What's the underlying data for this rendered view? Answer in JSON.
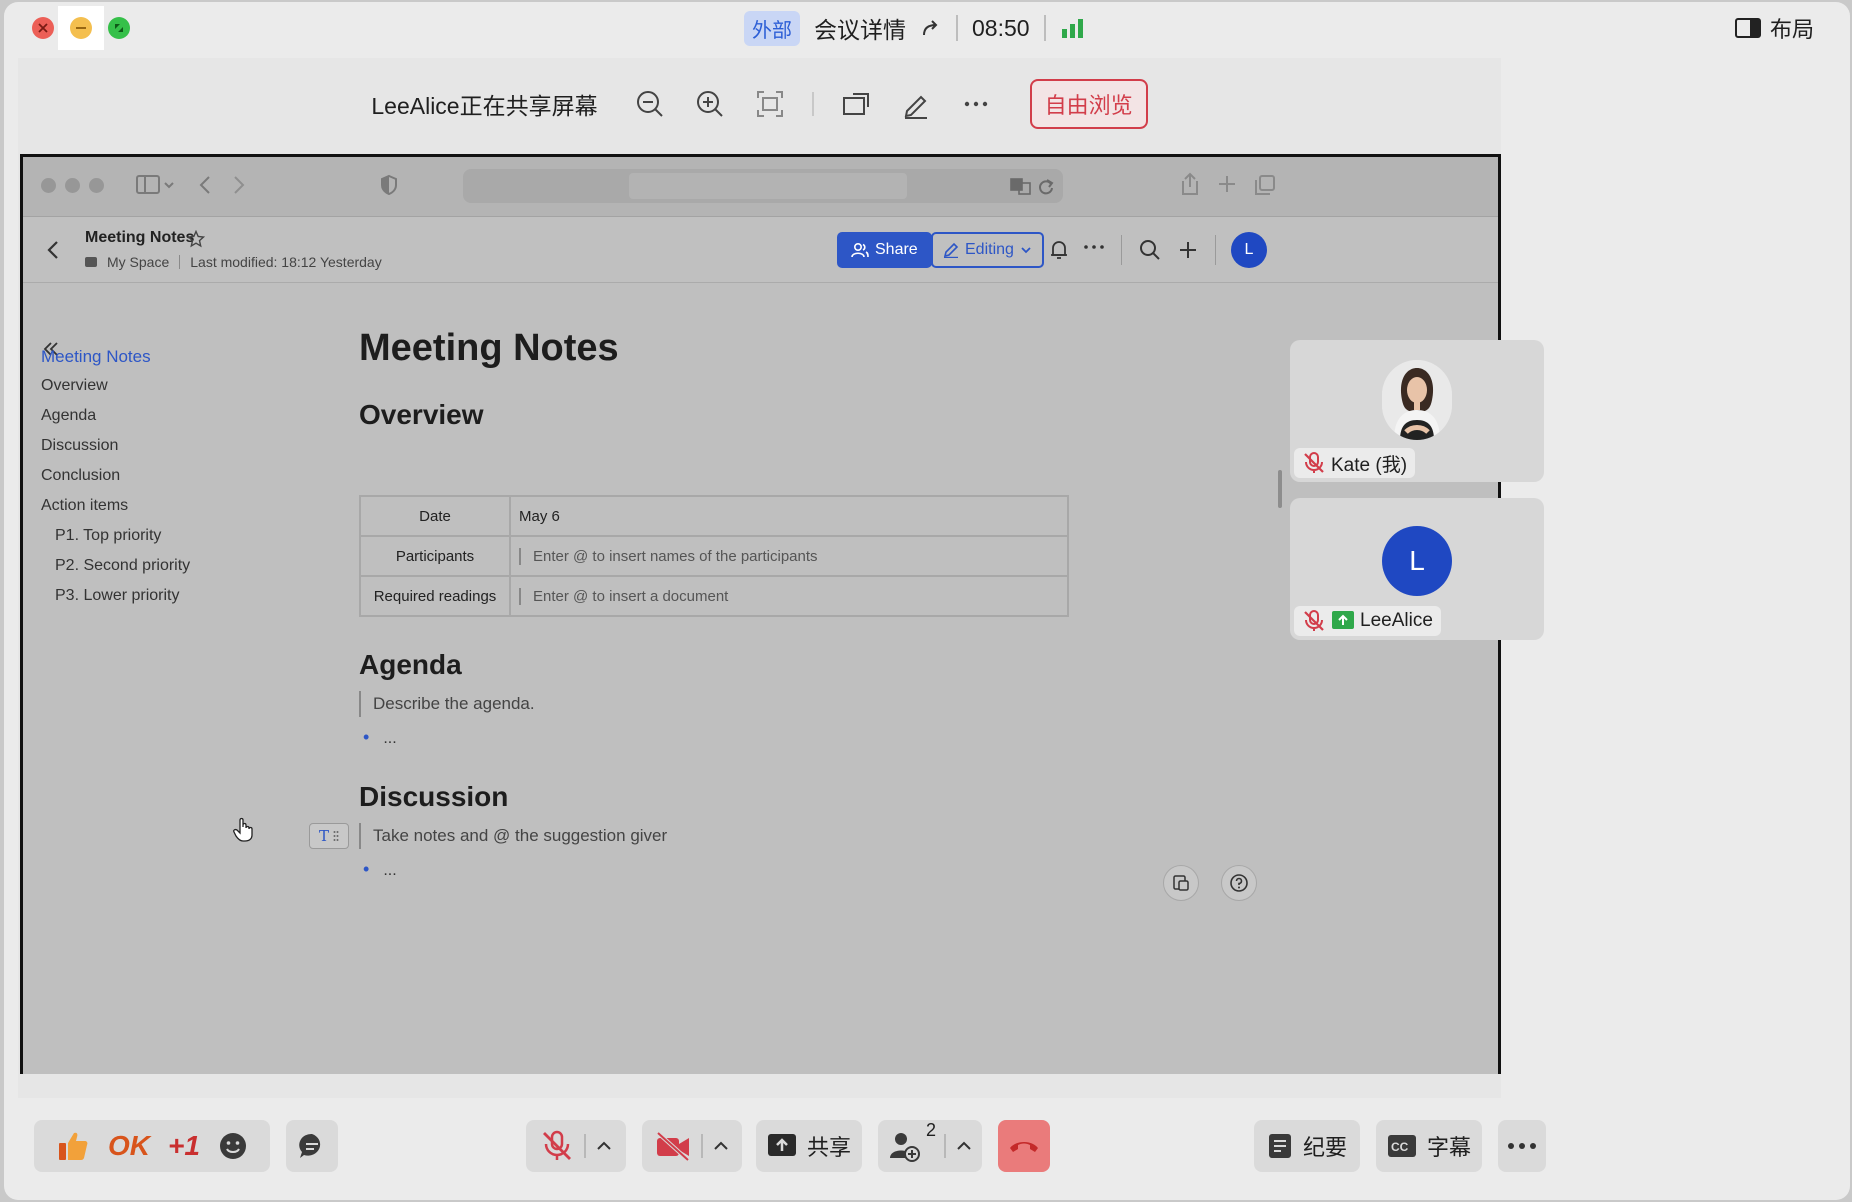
{
  "titlebar": {
    "external_badge": "外部",
    "meeting_details": "会议详情",
    "clock": "08:50",
    "layout_label": "布局"
  },
  "share_toolbar": {
    "title": "LeeAlice正在共享屏幕",
    "free_browse_label": "自由浏览"
  },
  "doc": {
    "breadcrumb_title": "Meeting Notes",
    "space": "My Space",
    "last_modified": "Last modified: 18:12 Yesterday",
    "share_label": "Share",
    "editing_label": "Editing",
    "avatar_initial": "L",
    "toc": {
      "items": [
        {
          "label": "Meeting Notes",
          "level": 1,
          "active": true
        },
        {
          "label": "Overview",
          "level": 1
        },
        {
          "label": "Agenda",
          "level": 1
        },
        {
          "label": "Discussion",
          "level": 1
        },
        {
          "label": "Conclusion",
          "level": 1
        },
        {
          "label": "Action items",
          "level": 1
        },
        {
          "label": "P1. Top priority",
          "level": 2
        },
        {
          "label": "P2. Second priority",
          "level": 2
        },
        {
          "label": "P3. Lower priority",
          "level": 2
        }
      ]
    },
    "title": "Meeting Notes",
    "overview_heading": "Overview",
    "table": [
      {
        "key": "Date",
        "value": "May 6",
        "placeholder": false
      },
      {
        "key": "Participants",
        "value": "Enter @ to insert names of the participants",
        "placeholder": true
      },
      {
        "key": "Required readings",
        "value": "Enter @ to insert a document",
        "placeholder": true
      }
    ],
    "agenda_heading": "Agenda",
    "agenda_placeholder": "Describe the agenda.",
    "agenda_bullet": "...",
    "discussion_heading": "Discussion",
    "discussion_placeholder": "Take notes and @ the suggestion giver",
    "discussion_bullet": "...",
    "block_type_icon": "T"
  },
  "participants": [
    {
      "name": "Kate (我)",
      "muted": true
    },
    {
      "name": "LeeAlice",
      "muted": true,
      "sharing": true,
      "initial": "L"
    }
  ],
  "bottom_bar": {
    "ok_label": "OK",
    "plus_one_label": "+1",
    "share_label": "共享",
    "participant_count": "2",
    "minutes_label": "纪要",
    "captions_label": "字幕"
  },
  "colors": {
    "accent_blue": "#2d56c6",
    "danger_red": "#d23d4a",
    "signal_green": "#2fa84a"
  }
}
